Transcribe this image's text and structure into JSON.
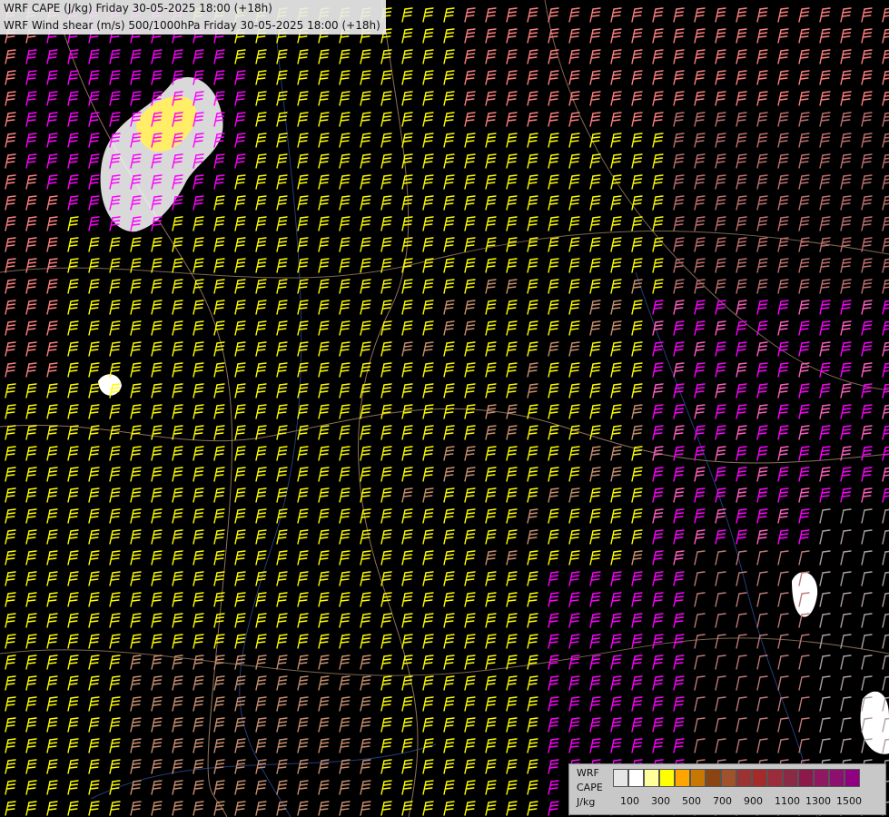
{
  "header": {
    "title_line1": "WRF CAPE (J/kg) Friday 30-05-2025 18:00 (+18h)",
    "title_line2": "WRF Wind shear (m/s) 500/1000hPa Friday 30-05-2025 18:00 (+18h)"
  },
  "legend": {
    "label_line1": "WRF",
    "label_line2": "CAPE",
    "label_line3": "J/kg",
    "colors": [
      "#e6e6e6",
      "#ffffff",
      "#ffff9a",
      "#ffff00",
      "#ffa500",
      "#c87800",
      "#8b4513",
      "#a0522d",
      "#9b3333",
      "#a52a2a",
      "#9b2c3c",
      "#8b2a45",
      "#8b1a4a",
      "#901860",
      "#8b1070",
      "#900080"
    ],
    "ticks": [
      "100",
      "300",
      "500",
      "700",
      "900",
      "1100",
      "1300",
      "1500"
    ]
  },
  "map_colors": {
    "background": "#000000",
    "shear_low": "#ffffff",
    "shear_mid_low": "#ffc080",
    "shear_mid": "#ffff00",
    "shear_mid_high": "#ff8080",
    "shear_high": "#ff00ff",
    "shear_brown": "#c89070",
    "shear_gray": "#b0a0a0",
    "cape_core": "#ffee66",
    "cape_edge": "#ffffff"
  }
}
